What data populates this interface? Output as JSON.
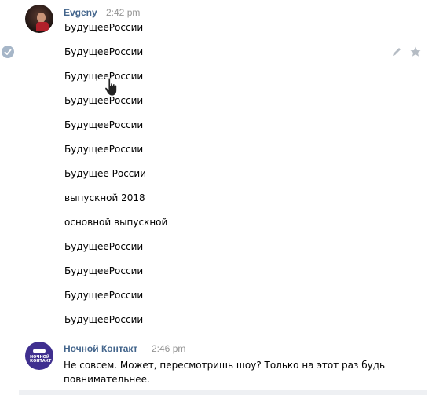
{
  "messages": {
    "evgeny": {
      "author": "Evgeny",
      "time": "2:42 pm",
      "lines": [
        "БудущееРоссии",
        "БудущееРоссии",
        "БудущееРоссии",
        "БудущееРоссии",
        "БудущееРоссии",
        "БудущееРоссии",
        "Будущее России",
        "выпускной 2018",
        "основной выпускной",
        "БудущееРоссии",
        "БудущееРоссии",
        "БудущееРоссии",
        "БудущееРоссии"
      ]
    },
    "nk": {
      "author": "Ночной Контакт",
      "time": "2:46 pm",
      "text": "Не совсем. Может, пересмотришь шоу? Только на этот раз будь повнимательнее.",
      "avatar_text": "НОЧНОЙ КОНТАКТ"
    }
  },
  "icons": {
    "selected": "check-circle-icon",
    "edit": "pencil-icon",
    "favorite": "star-icon",
    "cursor": "hand-pointer-icon"
  },
  "colors": {
    "author": "#42648b",
    "time": "#939393",
    "check": "#a6b6c8",
    "nk_avatar": "#3f2f8f"
  }
}
